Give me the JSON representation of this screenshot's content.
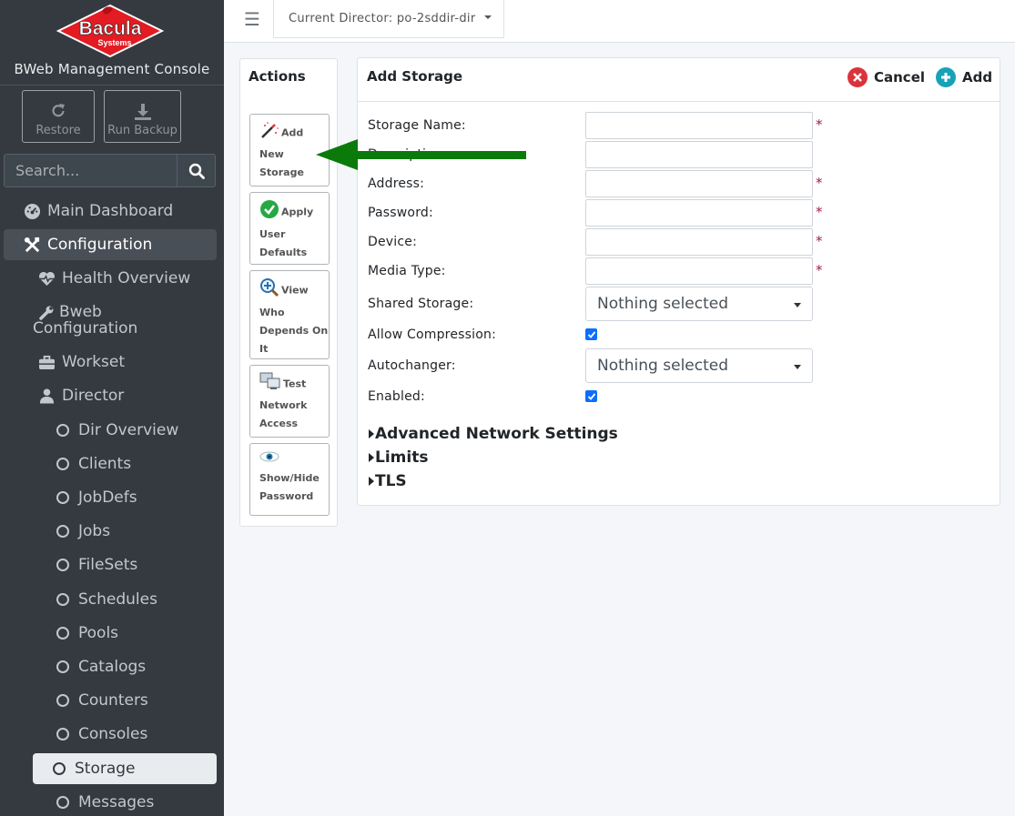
{
  "brand": {
    "logo_text": "Bacula",
    "logo_subtext": "Systems",
    "console_title": "BWeb Management Console"
  },
  "quick_buttons": {
    "restore": "Restore",
    "run_backup": "Run Backup"
  },
  "search": {
    "placeholder": "Search..."
  },
  "sidebar": {
    "items": [
      {
        "label": "Main Dashboard",
        "icon": "dashboard-icon"
      },
      {
        "label": "Configuration",
        "icon": "tools-icon"
      },
      {
        "label": "Health Overview",
        "icon": "heartbeat-icon"
      },
      {
        "label": "Bweb\nConfiguration",
        "icon": "wrench-icon"
      },
      {
        "label": "Workset",
        "icon": "briefcase-icon"
      },
      {
        "label": "Director",
        "icon": "user-icon"
      },
      {
        "label": "Dir Overview",
        "icon": "circle-icon"
      },
      {
        "label": "Clients",
        "icon": "circle-icon"
      },
      {
        "label": "JobDefs",
        "icon": "circle-icon"
      },
      {
        "label": "Jobs",
        "icon": "circle-icon"
      },
      {
        "label": "FileSets",
        "icon": "circle-icon"
      },
      {
        "label": "Schedules",
        "icon": "circle-icon"
      },
      {
        "label": "Pools",
        "icon": "circle-icon"
      },
      {
        "label": "Catalogs",
        "icon": "circle-icon"
      },
      {
        "label": "Counters",
        "icon": "circle-icon"
      },
      {
        "label": "Consoles",
        "icon": "circle-icon"
      },
      {
        "label": "Storage",
        "icon": "circle-icon"
      },
      {
        "label": "Messages",
        "icon": "circle-icon"
      }
    ]
  },
  "topbar": {
    "director_label": "Current Director: po-2sddir-dir"
  },
  "actions": {
    "title": "Actions",
    "buttons": [
      {
        "label_first": "Add",
        "label_rest": [
          "New",
          "Storage"
        ],
        "icon": "magic-wand-icon"
      },
      {
        "label_first": "Apply",
        "label_rest": [
          "User",
          "Defaults"
        ],
        "icon": "check-circle-icon"
      },
      {
        "label_first": "View",
        "label_rest": [
          "Who",
          "Depends On",
          "It"
        ],
        "icon": "search-plus-icon"
      },
      {
        "label_first": "Test",
        "label_rest": [
          "Network",
          "Access"
        ],
        "icon": "network-icon"
      },
      {
        "label_first": "",
        "label_rest": [
          "Show/Hide",
          "Password"
        ],
        "icon": "eye-icon"
      }
    ]
  },
  "form": {
    "title": "Add Storage",
    "cancel_label": "Cancel",
    "add_label": "Add",
    "fields": {
      "storage_name": "Storage Name:",
      "description": "Description:",
      "address": "Address:",
      "password": "Password:",
      "device": "Device:",
      "media_type": "Media Type:",
      "shared_storage": "Shared Storage:",
      "allow_compression": "Allow Compression:",
      "autochanger": "Autochanger:",
      "enabled": "Enabled:"
    },
    "required_mark": "*",
    "select_value": "Nothing selected",
    "allow_compression_checked": true,
    "enabled_checked": true,
    "sections": [
      "Advanced Network Settings",
      "Limits",
      "TLS"
    ]
  },
  "colors": {
    "sidebar_bg": "#343a40",
    "cancel_icon": "#d9343b",
    "add_icon": "#17a2b8",
    "arrow": "#0a7a0a",
    "checkbox": "#0d6efd"
  }
}
